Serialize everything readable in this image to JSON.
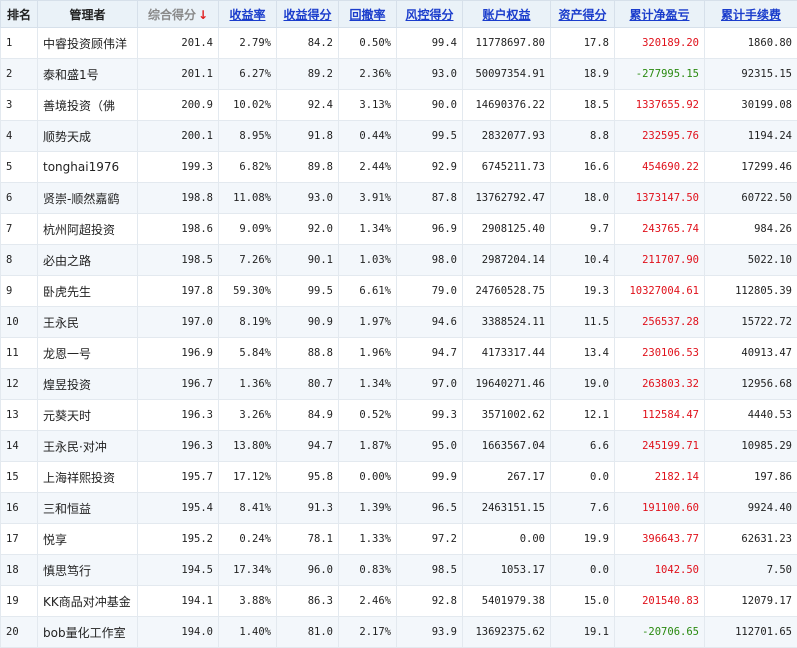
{
  "colors": {
    "header_bg": "#eaf2f8",
    "link": "#1b3dcc",
    "positive": "#e0101a",
    "negative": "#2a8a10",
    "sort_arrow": "#e02020"
  },
  "table": {
    "sort_arrow": "↓",
    "columns": [
      {
        "key": "rank",
        "label": "排名",
        "style": "plain"
      },
      {
        "key": "name",
        "label": "管理者",
        "style": "plain"
      },
      {
        "key": "score",
        "label": "综合得分",
        "style": "muted",
        "sorted": true
      },
      {
        "key": "return_rate",
        "label": "收益率",
        "style": "lnk"
      },
      {
        "key": "return_score",
        "label": "收益得分",
        "style": "lnk"
      },
      {
        "key": "drawdown",
        "label": "回撤率",
        "style": "lnk"
      },
      {
        "key": "risk_score",
        "label": "风控得分",
        "style": "lnk"
      },
      {
        "key": "equity",
        "label": "账户权益",
        "style": "lnk"
      },
      {
        "key": "asset_score",
        "label": "资产得分",
        "style": "lnk"
      },
      {
        "key": "cum_pnl",
        "label": "累计净盈亏",
        "style": "lnk"
      },
      {
        "key": "cum_fee",
        "label": "累计手续费",
        "style": "lnk"
      }
    ],
    "rows": [
      {
        "rank": "1",
        "name": "中睿投资顾伟洋",
        "score": "201.4",
        "return_rate": "2.79%",
        "return_score": "84.2",
        "drawdown": "0.50%",
        "risk_score": "99.4",
        "equity": "11778697.80",
        "asset_score": "17.8",
        "cum_pnl": "320189.20",
        "cum_fee": "1860.80",
        "pnl_sign": "pos"
      },
      {
        "rank": "2",
        "name": "泰和盛1号",
        "score": "201.1",
        "return_rate": "6.27%",
        "return_score": "89.2",
        "drawdown": "2.36%",
        "risk_score": "93.0",
        "equity": "50097354.91",
        "asset_score": "18.9",
        "cum_pnl": "-277995.15",
        "cum_fee": "92315.15",
        "pnl_sign": "neg"
      },
      {
        "rank": "3",
        "name": "善境投资（佛",
        "score": "200.9",
        "return_rate": "10.02%",
        "return_score": "92.4",
        "drawdown": "3.13%",
        "risk_score": "90.0",
        "equity": "14690376.22",
        "asset_score": "18.5",
        "cum_pnl": "1337655.92",
        "cum_fee": "30199.08",
        "pnl_sign": "pos"
      },
      {
        "rank": "4",
        "name": "顺势天成",
        "score": "200.1",
        "return_rate": "8.95%",
        "return_score": "91.8",
        "drawdown": "0.44%",
        "risk_score": "99.5",
        "equity": "2832077.93",
        "asset_score": "8.8",
        "cum_pnl": "232595.76",
        "cum_fee": "1194.24",
        "pnl_sign": "pos"
      },
      {
        "rank": "5",
        "name": "tonghai1976",
        "score": "199.3",
        "return_rate": "6.82%",
        "return_score": "89.8",
        "drawdown": "2.44%",
        "risk_score": "92.9",
        "equity": "6745211.73",
        "asset_score": "16.6",
        "cum_pnl": "454690.22",
        "cum_fee": "17299.46",
        "pnl_sign": "pos"
      },
      {
        "rank": "6",
        "name": "贤崇-顺然嘉鹞",
        "score": "198.8",
        "return_rate": "11.08%",
        "return_score": "93.0",
        "drawdown": "3.91%",
        "risk_score": "87.8",
        "equity": "13762792.47",
        "asset_score": "18.0",
        "cum_pnl": "1373147.50",
        "cum_fee": "60722.50",
        "pnl_sign": "pos"
      },
      {
        "rank": "7",
        "name": "杭州阿超投资",
        "score": "198.6",
        "return_rate": "9.09%",
        "return_score": "92.0",
        "drawdown": "1.34%",
        "risk_score": "96.9",
        "equity": "2908125.40",
        "asset_score": "9.7",
        "cum_pnl": "243765.74",
        "cum_fee": "984.26",
        "pnl_sign": "pos"
      },
      {
        "rank": "8",
        "name": "必由之路",
        "score": "198.5",
        "return_rate": "7.26%",
        "return_score": "90.1",
        "drawdown": "1.03%",
        "risk_score": "98.0",
        "equity": "2987204.14",
        "asset_score": "10.4",
        "cum_pnl": "211707.90",
        "cum_fee": "5022.10",
        "pnl_sign": "pos"
      },
      {
        "rank": "9",
        "name": "卧虎先生",
        "score": "197.8",
        "return_rate": "59.30%",
        "return_score": "99.5",
        "drawdown": "6.61%",
        "risk_score": "79.0",
        "equity": "24760528.75",
        "asset_score": "19.3",
        "cum_pnl": "10327004.61",
        "cum_fee": "112805.39",
        "pnl_sign": "pos"
      },
      {
        "rank": "10",
        "name": "王永民",
        "score": "197.0",
        "return_rate": "8.19%",
        "return_score": "90.9",
        "drawdown": "1.97%",
        "risk_score": "94.6",
        "equity": "3388524.11",
        "asset_score": "11.5",
        "cum_pnl": "256537.28",
        "cum_fee": "15722.72",
        "pnl_sign": "pos"
      },
      {
        "rank": "11",
        "name": "龙恩一号",
        "score": "196.9",
        "return_rate": "5.84%",
        "return_score": "88.8",
        "drawdown": "1.96%",
        "risk_score": "94.7",
        "equity": "4173317.44",
        "asset_score": "13.4",
        "cum_pnl": "230106.53",
        "cum_fee": "40913.47",
        "pnl_sign": "pos"
      },
      {
        "rank": "12",
        "name": "煌昱投资",
        "score": "196.7",
        "return_rate": "1.36%",
        "return_score": "80.7",
        "drawdown": "1.34%",
        "risk_score": "97.0",
        "equity": "19640271.46",
        "asset_score": "19.0",
        "cum_pnl": "263803.32",
        "cum_fee": "12956.68",
        "pnl_sign": "pos"
      },
      {
        "rank": "13",
        "name": "元葵天时",
        "score": "196.3",
        "return_rate": "3.26%",
        "return_score": "84.9",
        "drawdown": "0.52%",
        "risk_score": "99.3",
        "equity": "3571002.62",
        "asset_score": "12.1",
        "cum_pnl": "112584.47",
        "cum_fee": "4440.53",
        "pnl_sign": "pos"
      },
      {
        "rank": "14",
        "name": "王永民·对冲",
        "score": "196.3",
        "return_rate": "13.80%",
        "return_score": "94.7",
        "drawdown": "1.87%",
        "risk_score": "95.0",
        "equity": "1663567.04",
        "asset_score": "6.6",
        "cum_pnl": "245199.71",
        "cum_fee": "10985.29",
        "pnl_sign": "pos"
      },
      {
        "rank": "15",
        "name": "上海祥熙投资",
        "score": "195.7",
        "return_rate": "17.12%",
        "return_score": "95.8",
        "drawdown": "0.00%",
        "risk_score": "99.9",
        "equity": "267.17",
        "asset_score": "0.0",
        "cum_pnl": "2182.14",
        "cum_fee": "197.86",
        "pnl_sign": "pos"
      },
      {
        "rank": "16",
        "name": "三和恒益",
        "score": "195.4",
        "return_rate": "8.41%",
        "return_score": "91.3",
        "drawdown": "1.39%",
        "risk_score": "96.5",
        "equity": "2463151.15",
        "asset_score": "7.6",
        "cum_pnl": "191100.60",
        "cum_fee": "9924.40",
        "pnl_sign": "pos"
      },
      {
        "rank": "17",
        "name": "悦享",
        "score": "195.2",
        "return_rate": "0.24%",
        "return_score": "78.1",
        "drawdown": "1.33%",
        "risk_score": "97.2",
        "equity": "0.00",
        "asset_score": "19.9",
        "cum_pnl": "396643.77",
        "cum_fee": "62631.23",
        "pnl_sign": "pos"
      },
      {
        "rank": "18",
        "name": "慎思笃行",
        "score": "194.5",
        "return_rate": "17.34%",
        "return_score": "96.0",
        "drawdown": "0.83%",
        "risk_score": "98.5",
        "equity": "1053.17",
        "asset_score": "0.0",
        "cum_pnl": "1042.50",
        "cum_fee": "7.50",
        "pnl_sign": "pos"
      },
      {
        "rank": "19",
        "name": "KK商品对冲基金",
        "score": "194.1",
        "return_rate": "3.88%",
        "return_score": "86.3",
        "drawdown": "2.46%",
        "risk_score": "92.8",
        "equity": "5401979.38",
        "asset_score": "15.0",
        "cum_pnl": "201540.83",
        "cum_fee": "12079.17",
        "pnl_sign": "pos"
      },
      {
        "rank": "20",
        "name": "bob量化工作室",
        "score": "194.0",
        "return_rate": "1.40%",
        "return_score": "81.0",
        "drawdown": "2.17%",
        "risk_score": "93.9",
        "equity": "13692375.62",
        "asset_score": "19.1",
        "cum_pnl": "-20706.65",
        "cum_fee": "112701.65",
        "pnl_sign": "neg"
      }
    ]
  }
}
